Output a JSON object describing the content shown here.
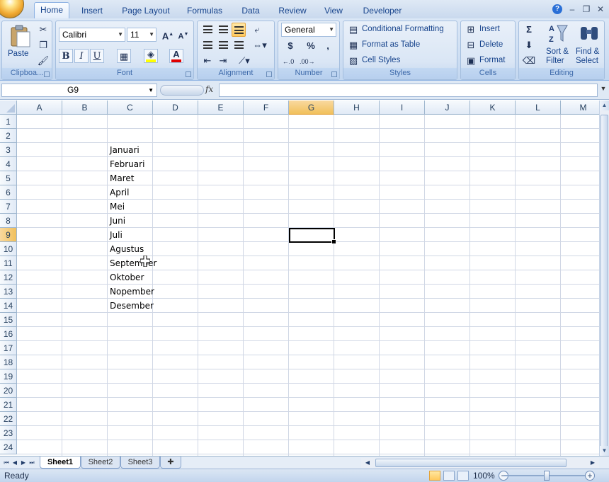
{
  "ribbon_tabs": [
    "Home",
    "Insert",
    "Page Layout",
    "Formulas",
    "Data",
    "Review",
    "View",
    "Developer"
  ],
  "active_tab": "Home",
  "clipboard": {
    "paste_label": "Paste",
    "group_label": "Clipboa..."
  },
  "font": {
    "name": "Calibri",
    "size": "11",
    "group_label": "Font",
    "bold": "B",
    "italic": "I",
    "underline": "U"
  },
  "alignment": {
    "group_label": "Alignment"
  },
  "number": {
    "format": "General",
    "currency": "$",
    "percent": "%",
    "comma": ",",
    "group_label": "Number"
  },
  "styles": {
    "conditional": "Conditional Formatting",
    "format_table": "Format as Table",
    "cell_styles": "Cell Styles",
    "group_label": "Styles"
  },
  "cells": {
    "insert": "Insert",
    "delete": "Delete",
    "format": "Format",
    "group_label": "Cells"
  },
  "editing": {
    "sort_line1": "Sort &",
    "sort_line2": "Filter",
    "find_line1": "Find &",
    "find_line2": "Select",
    "group_label": "Editing",
    "sigma": "Σ"
  },
  "formula_bar": {
    "name_box": "G9",
    "fx": "fx",
    "formula": ""
  },
  "columns": [
    "A",
    "B",
    "C",
    "D",
    "E",
    "F",
    "G",
    "H",
    "I",
    "J",
    "K",
    "L",
    "M"
  ],
  "rows": [
    "1",
    "2",
    "3",
    "4",
    "5",
    "6",
    "7",
    "8",
    "9",
    "10",
    "11",
    "12",
    "13",
    "14",
    "15",
    "16",
    "17",
    "18",
    "19",
    "20",
    "21",
    "22",
    "23",
    "24"
  ],
  "cells_data": {
    "C3": "Januari",
    "C4": "Februari",
    "C5": "Maret",
    "C6": "April",
    "C7": "Mei",
    "C8": "Juni",
    "C9": "Juli",
    "C10": "Agustus",
    "C11": "September",
    "C12": "Oktober",
    "C13": "Nopember",
    "C14": "Desember"
  },
  "active_cell": "G9",
  "sheets": [
    "Sheet1",
    "Sheet2",
    "Sheet3"
  ],
  "active_sheet": "Sheet1",
  "status": {
    "ready": "Ready",
    "zoom": "100%"
  }
}
